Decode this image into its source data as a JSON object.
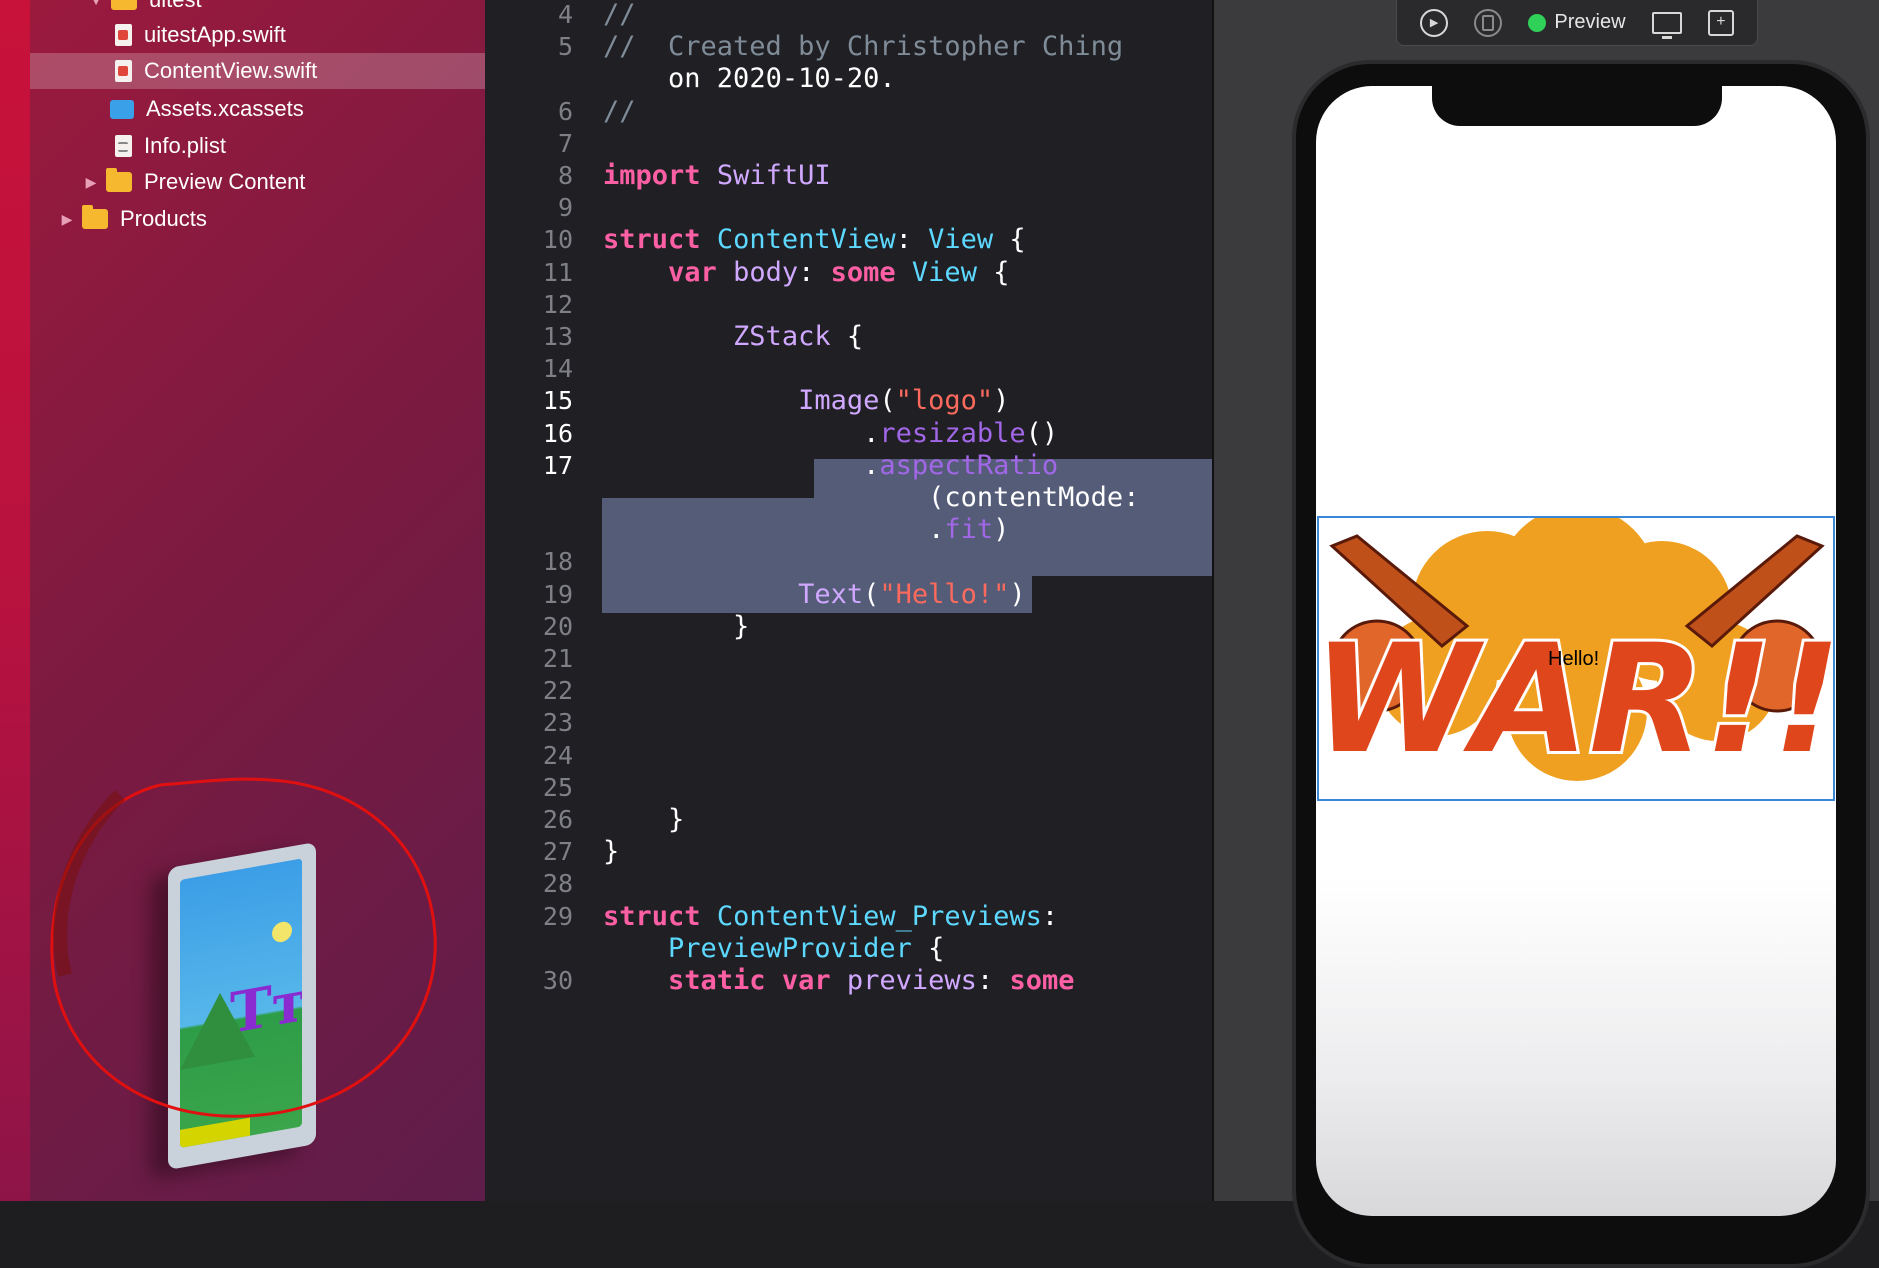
{
  "navigator": {
    "items": [
      {
        "label": "uitest",
        "kind": "folder"
      },
      {
        "label": "uitestApp.swift",
        "kind": "swift"
      },
      {
        "label": "ContentView.swift",
        "kind": "swift",
        "selected": true
      },
      {
        "label": "Assets.xcassets",
        "kind": "assets"
      },
      {
        "label": "Info.plist",
        "kind": "plist"
      },
      {
        "label": "Preview Content",
        "kind": "folder",
        "collapsed": true
      },
      {
        "label": "Products",
        "kind": "folder",
        "collapsed": true
      }
    ]
  },
  "editor": {
    "lines": [
      {
        "num": "4",
        "text": "//"
      },
      {
        "num": "5",
        "text": "//  Created by Christopher Ching"
      },
      {
        "num": "",
        "text": "    on 2020-10-20."
      },
      {
        "num": "6",
        "text": "//"
      },
      {
        "num": "7",
        "text": ""
      },
      {
        "num": "8",
        "text": "import SwiftUI"
      },
      {
        "num": "9",
        "text": ""
      },
      {
        "num": "10",
        "text": "struct ContentView: View {"
      },
      {
        "num": "11",
        "text": "    var body: some View {"
      },
      {
        "num": "12",
        "text": ""
      },
      {
        "num": "13",
        "text": "        ZStack {"
      },
      {
        "num": "14",
        "text": ""
      },
      {
        "num": "15",
        "text": "            Image(\"logo\")"
      },
      {
        "num": "16",
        "text": "                .resizable()"
      },
      {
        "num": "17",
        "text": "                .aspectRatio"
      },
      {
        "num": "",
        "text": "                    (contentMode:"
      },
      {
        "num": "",
        "text": "                    .fit)"
      },
      {
        "num": "18",
        "text": ""
      },
      {
        "num": "19",
        "text": "            Text(\"Hello!\")"
      },
      {
        "num": "20",
        "text": "        }"
      },
      {
        "num": "21",
        "text": ""
      },
      {
        "num": "22",
        "text": ""
      },
      {
        "num": "23",
        "text": ""
      },
      {
        "num": "24",
        "text": ""
      },
      {
        "num": "25",
        "text": ""
      },
      {
        "num": "26",
        "text": "    }"
      },
      {
        "num": "27",
        "text": "}"
      },
      {
        "num": "28",
        "text": ""
      },
      {
        "num": "29",
        "text": "struct ContentView_Previews:"
      },
      {
        "num": "",
        "text": "    PreviewProvider {"
      },
      {
        "num": "30",
        "text": "    static var previews: some"
      }
    ],
    "active_lines": [
      "15",
      "16",
      "17"
    ]
  },
  "preview_toolbar": {
    "live_label": "Preview",
    "icons": [
      "play-icon",
      "device-icon",
      "live-dot",
      "monitor-icon",
      "duplicate-icon"
    ]
  },
  "preview": {
    "logo_text": "WAR!!",
    "overlay_text": "Hello!"
  },
  "colors": {
    "keyword": "#fc5fa3",
    "type": "#5dd8ff",
    "string": "#fc6a5d",
    "method": "#a167e6",
    "selection": "#545c78",
    "live": "#2fd158",
    "annotation": "#e01010"
  }
}
